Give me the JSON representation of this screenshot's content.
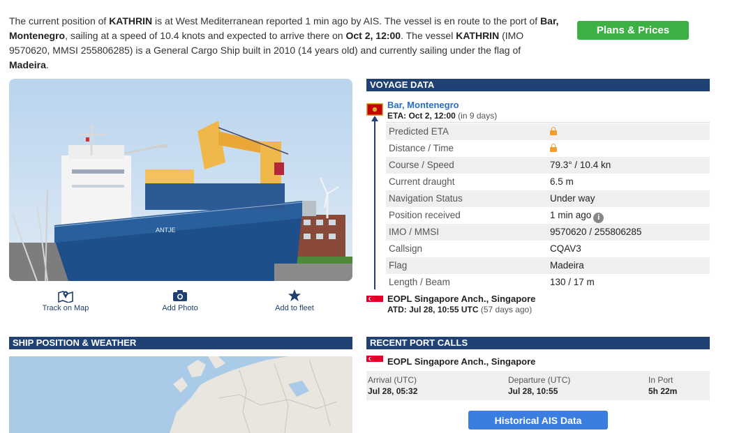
{
  "intro": {
    "t1": "The current position of ",
    "vessel_name": "KATHRIN",
    "t2": " is at West Mediterranean reported 1 min ago by AIS. The vessel is en route to the port of ",
    "dest": "Bar, Montenegro",
    "t3": ", sailing at a speed of 10.4 knots and expected to arrive there on ",
    "eta": "Oct 2, 12:00",
    "t4": ". The vessel ",
    "vessel_name2": "KATHRIN",
    "t5": " (IMO 9570620, MMSI 255806285) is a General Cargo Ship built in 2010 (14 years old) and currently sailing under the flag of ",
    "flag": "Madeira",
    "t6": "."
  },
  "plans_button": "Plans & Prices",
  "actions": {
    "track": "Track on Map",
    "photo": "Add Photo",
    "fleet": "Add to fleet"
  },
  "ship_photo": {
    "hull_text": "ANTJE"
  },
  "voyage": {
    "header": "VOYAGE DATA",
    "dest_port": "Bar, Montenegro",
    "eta_label": "ETA:",
    "eta_value": "Oct 2, 12:00",
    "eta_note": "(in 9 days)",
    "rows": [
      {
        "label": "Predicted ETA",
        "value": ""
      },
      {
        "label": "Distance / Time",
        "value": ""
      },
      {
        "label": "Course / Speed",
        "value": "79.3° / 10.4 kn"
      },
      {
        "label": "Current draught",
        "value": "6.5 m"
      },
      {
        "label": "Navigation Status",
        "value": "Under way"
      },
      {
        "label": "Position received",
        "value": "1 min ago"
      },
      {
        "label": "IMO / MMSI",
        "value": "9570620 / 255806285"
      },
      {
        "label": "Callsign",
        "value": "CQAV3"
      },
      {
        "label": "Flag",
        "value": "Madeira"
      },
      {
        "label": "Length / Beam",
        "value": "130 / 17 m"
      }
    ],
    "origin_port": "EOPL Singapore Anch., Singapore",
    "atd_label": "ATD:",
    "atd_value": "Jul 28, 10:55 UTC",
    "atd_note": "(57 days ago)"
  },
  "position_weather": {
    "header": "SHIP POSITION & WEATHER"
  },
  "recent_port_calls": {
    "header": "RECENT PORT CALLS",
    "port": "EOPL Singapore Anch., Singapore",
    "arrival_label": "Arrival (UTC)",
    "arrival_value": "Jul 28, 05:32",
    "departure_label": "Departure (UTC)",
    "departure_value": "Jul 28, 10:55",
    "inport_label": "In Port",
    "inport_value": "5h 22m"
  },
  "historical_button": "Historical AIS Data",
  "colors": {
    "header_bg": "#1f4173",
    "green_button": "#3cb043",
    "blue_button": "#3a7fe0",
    "link": "#2a6cc4",
    "lock": "#f0a030"
  },
  "icons": [
    "map-pin-icon",
    "camera-icon",
    "star-icon",
    "lock-icon",
    "info-icon",
    "montenegro-flag-icon",
    "singapore-flag-icon"
  ]
}
